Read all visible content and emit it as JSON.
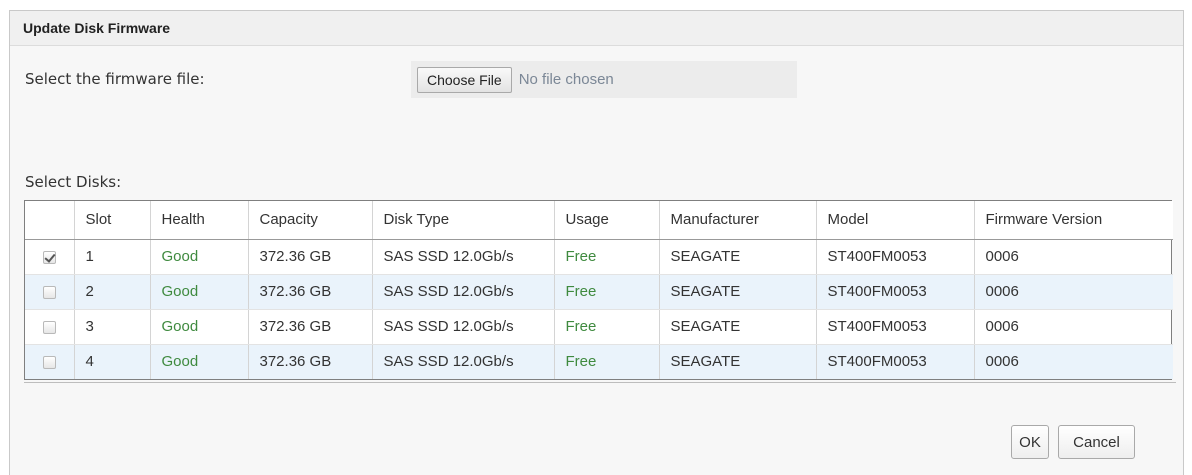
{
  "dialog": {
    "title": "Update Disk Firmware",
    "file_label": "Select the firmware file:",
    "choose_file_label": "Choose File",
    "file_status": "No file chosen",
    "disks_label": "Select Disks:",
    "ok_label": "OK",
    "cancel_label": "Cancel"
  },
  "table": {
    "headers": [
      "",
      "Slot",
      "Health",
      "Capacity",
      "Disk Type",
      "Usage",
      "Manufacturer",
      "Model",
      "Firmware Version"
    ],
    "rows": [
      {
        "checked": true,
        "slot": "1",
        "health": "Good",
        "capacity": "372.36 GB",
        "disk_type": "SAS SSD 12.0Gb/s",
        "usage": "Free",
        "manufacturer": "SEAGATE",
        "model": "ST400FM0053",
        "firmware": "0006"
      },
      {
        "checked": false,
        "slot": "2",
        "health": "Good",
        "capacity": "372.36 GB",
        "disk_type": "SAS SSD 12.0Gb/s",
        "usage": "Free",
        "manufacturer": "SEAGATE",
        "model": "ST400FM0053",
        "firmware": "0006"
      },
      {
        "checked": false,
        "slot": "3",
        "health": "Good",
        "capacity": "372.36 GB",
        "disk_type": "SAS SSD 12.0Gb/s",
        "usage": "Free",
        "manufacturer": "SEAGATE",
        "model": "ST400FM0053",
        "firmware": "0006"
      },
      {
        "checked": false,
        "slot": "4",
        "health": "Good",
        "capacity": "372.36 GB",
        "disk_type": "SAS SSD 12.0Gb/s",
        "usage": "Free",
        "manufacturer": "SEAGATE",
        "model": "ST400FM0053",
        "firmware": "0006"
      }
    ]
  },
  "colors": {
    "status_green": "#3f8a3f",
    "row_stripe": "#eaf3fb",
    "file_status_text": "#7b8796"
  }
}
